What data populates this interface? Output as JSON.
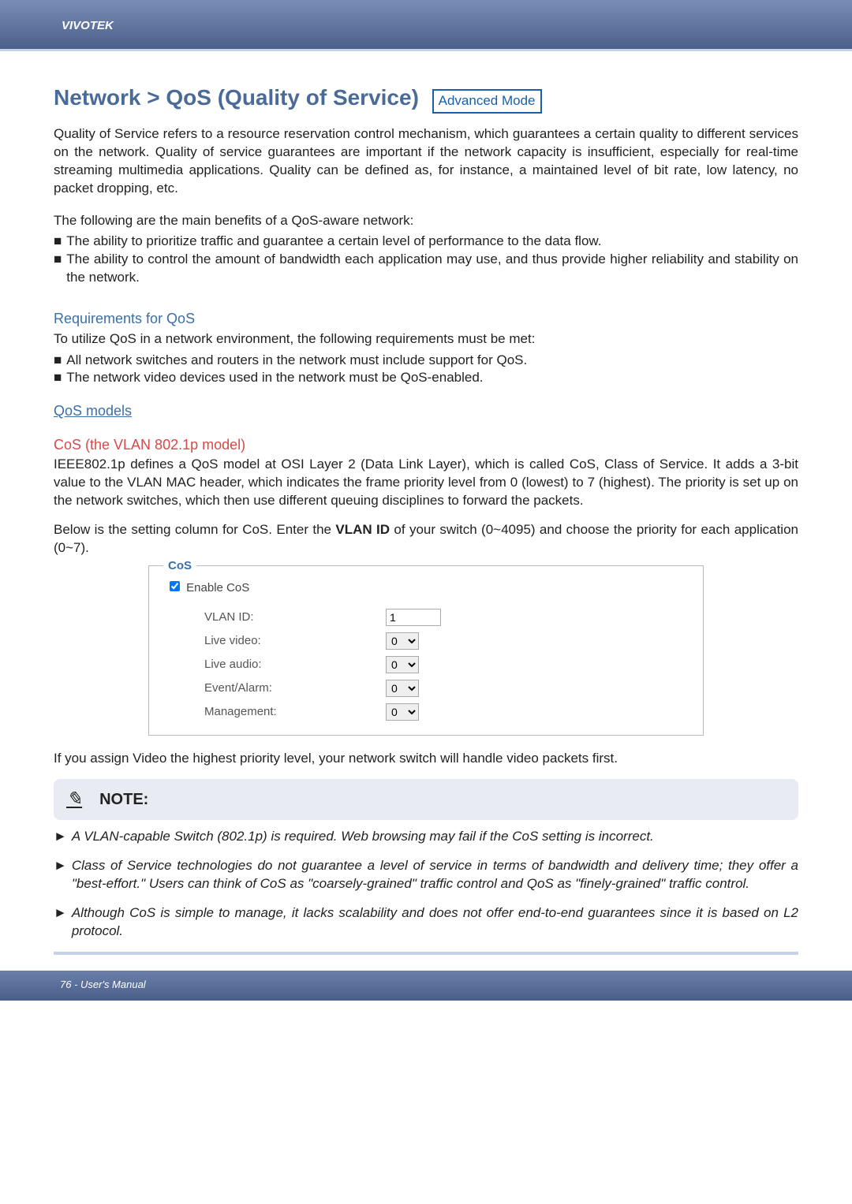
{
  "header": {
    "brand": "VIVOTEK"
  },
  "title": "Network > QoS (Quality of Service)",
  "advanced_mode": "Advanced Mode",
  "intro_para": "Quality of Service refers to a resource reservation control mechanism, which guarantees a certain quality to different services on the network. Quality of service guarantees are important if the network capacity is insufficient, especially for real-time streaming multimedia applications. Quality can be defined as, for instance, a maintained level of bit rate, low latency, no packet dropping, etc.",
  "benefits_lead": "The following are the main benefits of a QoS-aware network:",
  "benefits": [
    "The ability to prioritize traffic and guarantee a certain level of performance to the data flow.",
    "The ability to control the amount of bandwidth each application may use, and thus provide higher reliability and stability on the network."
  ],
  "requirements": {
    "heading": "Requirements for QoS",
    "lead": "To utilize QoS in a network environment, the following requirements must be met:",
    "items": [
      "All network switches and routers in the network must include support for QoS.",
      "The network video devices used in the network must be QoS-enabled."
    ]
  },
  "qos_models_heading": "QoS models",
  "cos_section": {
    "heading": "CoS (the VLAN 802.1p model)",
    "para1": "IEEE802.1p defines a QoS model at OSI Layer 2 (Data Link Layer), which is called CoS, Class of Service. It adds a 3-bit value to the VLAN MAC header, which indicates the frame priority level from 0 (lowest) to 7 (highest). The priority is set up on the network switches, which then use different queuing disciplines to forward the packets.",
    "para2_pre": "Below is the setting column for CoS. Enter the ",
    "para2_bold": "VLAN ID",
    "para2_post": " of your switch (0~4095) and choose the priority for each application (0~7)."
  },
  "cos_box": {
    "legend": "CoS",
    "enable_label": "Enable CoS",
    "rows": {
      "vlan_id": {
        "label": "VLAN ID:",
        "value": "1"
      },
      "live_video": {
        "label": "Live video:",
        "value": "0"
      },
      "live_audio": {
        "label": "Live audio:",
        "value": "0"
      },
      "event_alarm": {
        "label": "Event/Alarm:",
        "value": "0"
      },
      "management": {
        "label": "Management:",
        "value": "0"
      }
    }
  },
  "after_box": "If you assign Video the highest priority level, your network switch will handle video packets first.",
  "note": {
    "title": "NOTE:",
    "items": [
      "A VLAN-capable Switch (802.1p) is required. Web browsing may fail if the CoS setting is incorrect.",
      "Class of Service technologies do not guarantee a level of service in terms of bandwidth and delivery time; they offer a \"best-effort.\" Users can think of CoS as \"coarsely-grained\" traffic control and QoS as \"finely-grained\" traffic control.",
      "Although CoS is simple to manage, it lacks scalability and does not offer end-to-end guarantees since it is based on L2 protocol."
    ]
  },
  "footer": "76 - User's Manual"
}
